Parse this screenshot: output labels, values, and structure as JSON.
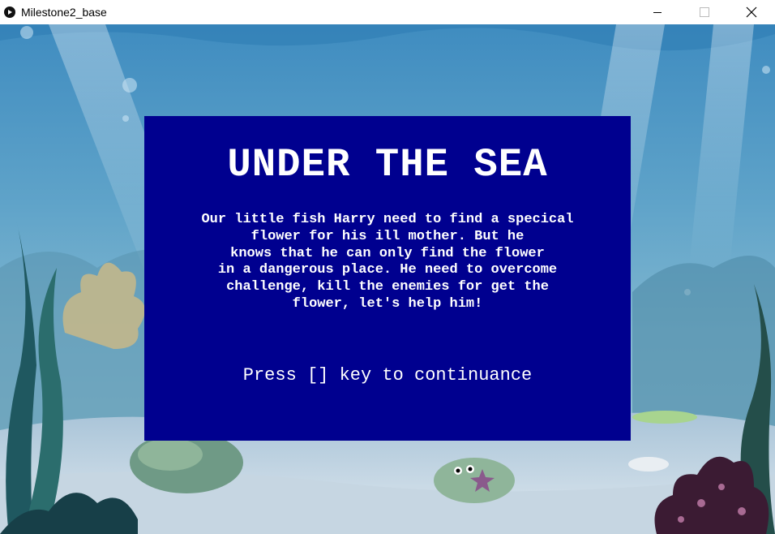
{
  "window": {
    "title": "Milestone2_base",
    "icon": "play-icon",
    "controls": [
      "minimize-icon",
      "maximize-icon",
      "close-icon"
    ]
  },
  "intro": {
    "title": "UNDER THE SEA",
    "story_lines": [
      "Our little fish Harry need to find a specical",
      "flower for his ill mother. But he",
      "knows that he can only find the flower",
      "in a dangerous place. He need to overcome",
      "challenge, kill the enemies for get the",
      "flower, let's help him!"
    ],
    "prompt": "Press [] key to continuance"
  },
  "colors": {
    "panel": "#00008f",
    "text": "#ffffff",
    "water_top": "#5a9ec7",
    "sand": "#b9c9d9"
  }
}
